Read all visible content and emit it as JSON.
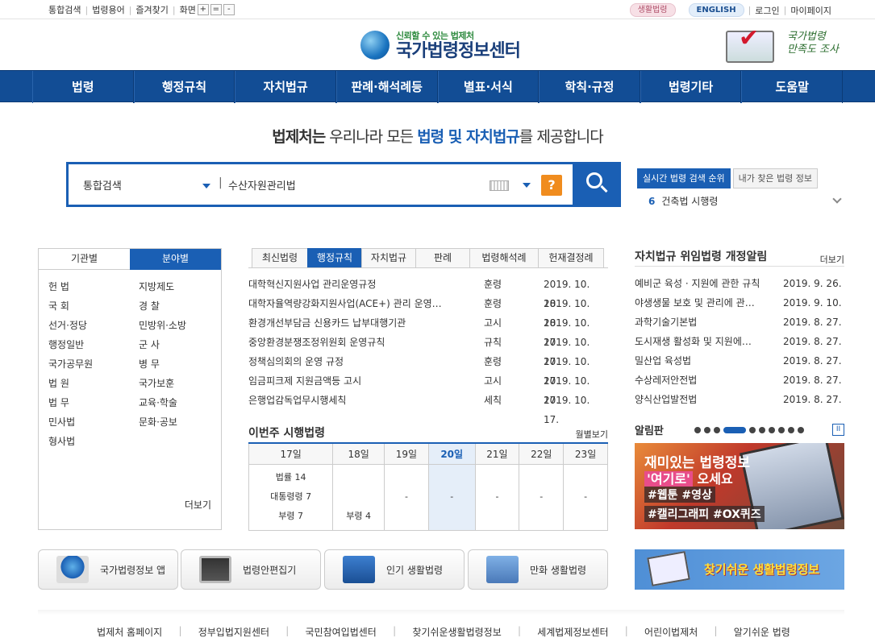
{
  "topbar": {
    "util": [
      "통합검색",
      "법령용어",
      "즐겨찾기"
    ],
    "screen_label": "화면",
    "zoom": [
      "+",
      "=",
      "-"
    ],
    "life_law": "생활법령",
    "english": "ENGLISH",
    "login": "로그인",
    "mypage": "마이페이지"
  },
  "logo": {
    "tagline": "신뢰할 수 있는 법제처",
    "name": "국가법령정보센터"
  },
  "survey": {
    "line1": "국가법령",
    "line2": "만족도 조사"
  },
  "nav": [
    "법령",
    "행정규칙",
    "자치법규",
    "판례·해석례등",
    "별표·서식",
    "학칙·규정",
    "법령기타",
    "도움말"
  ],
  "slogan": {
    "p1": "법제처는",
    "p2": " 우리나라 모든 ",
    "p3": "법령 및 자치법규",
    "p4": "를 제공합니다"
  },
  "search": {
    "scope": "통합검색",
    "divider": "|",
    "query": "수산자원관리법",
    "help": "?"
  },
  "rank": {
    "tabs": [
      "실시간 법령 검색 순위",
      "내가 찾은 법령 정보"
    ],
    "current_no": "6",
    "current_title": "건축법 시행령"
  },
  "category": {
    "tabs": [
      "기관별",
      "분야별"
    ],
    "items": [
      "헌 법",
      "지방제도",
      "국 회",
      "경 찰",
      "선거·정당",
      "민방위·소방",
      "행정일반",
      "군 사",
      "국가공무원",
      "병 무",
      "법 원",
      "국가보훈",
      "법 무",
      "교육·학술",
      "민사법",
      "문화·공보",
      "형사법"
    ],
    "more": "더보기"
  },
  "latest": {
    "tabs": [
      "최신법령",
      "행정규칙",
      "자치법규",
      "판례",
      "법령해석례",
      "헌재결정례"
    ],
    "rows": [
      {
        "title": "대학혁신지원사업 관리운영규정",
        "kind": "훈령",
        "date": "2019. 10. 18."
      },
      {
        "title": "대학자율역량강화지원사업(ACE+) 관리 운영…",
        "kind": "훈령",
        "date": "2019. 10. 18."
      },
      {
        "title": "환경개선부담금 신용카드 납부대행기관",
        "kind": "고시",
        "date": "2019. 10. 17."
      },
      {
        "title": "중앙환경분쟁조정위원회 운영규칙",
        "kind": "규칙",
        "date": "2019. 10. 17."
      },
      {
        "title": "정책심의회의 운영 규정",
        "kind": "훈령",
        "date": "2019. 10. 17."
      },
      {
        "title": "임금피크제 지원금액등 고시",
        "kind": "고시",
        "date": "2019. 10. 17."
      },
      {
        "title": "은행업감독업무시행세칙",
        "kind": "세칙",
        "date": "2019. 10. 17."
      }
    ]
  },
  "week": {
    "title": "이번주 시행법령",
    "monthly": "월별보기",
    "days": [
      "17일",
      "18일",
      "19일",
      "20일",
      "21일",
      "22일",
      "23일"
    ],
    "cells": [
      [
        "법률 14",
        "대통령령 7",
        "부령 7"
      ],
      [
        "부령 4"
      ],
      [
        "-"
      ],
      [
        "-"
      ],
      [
        "-"
      ],
      [
        "-"
      ],
      [
        "-"
      ]
    ]
  },
  "notice": {
    "title": "자치법규 위임법령 개정알림",
    "more": "더보기",
    "rows": [
      {
        "title": "예비군 육성 · 지원에 관한 규칙",
        "date": "2019. 9. 26."
      },
      {
        "title": "야생생물 보호 및 관리에 관…",
        "date": "2019. 9. 10."
      },
      {
        "title": "과학기술기본법",
        "date": "2019. 8. 27."
      },
      {
        "title": "도시재생 활성화 및 지원에…",
        "date": "2019. 8. 27."
      },
      {
        "title": "밀산업 육성법",
        "date": "2019. 8. 27."
      },
      {
        "title": "수상레저안전법",
        "date": "2019. 8. 27."
      },
      {
        "title": "양식산업발전법",
        "date": "2019. 8. 27."
      }
    ]
  },
  "board": {
    "title": "알림판",
    "pause": "II",
    "banner": {
      "line1": "재미있는 법령정보",
      "line2a": "'여기로'",
      "line2b": " 오세요",
      "line3": "#웹툰 #영상",
      "line4": "#캘리그래피 #OX퀴즈"
    }
  },
  "quick": [
    "국가법령정보 앱",
    "법령안편집기",
    "인기 생활법령",
    "만화 생활법령"
  ],
  "life_banner": "찾기쉬운 생활법령정보",
  "footer": [
    "법제처 홈페이지",
    "정부입법지원센터",
    "국민참여입법센터",
    "찾기쉬운생활법령정보",
    "세계법제정보센터",
    "어린이법제처",
    "알기쉬운 법령"
  ],
  "colors": {
    "brand": "#1a5fb4",
    "nav": "#124d95",
    "help": "#f08c1e"
  }
}
